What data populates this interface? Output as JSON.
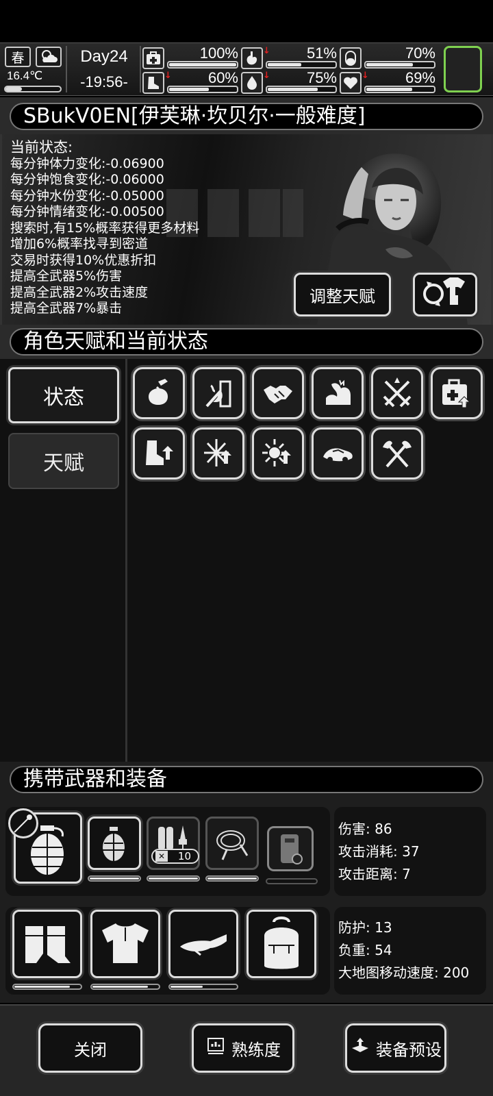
{
  "topbar": {
    "season": "春",
    "temperature": "16.4℃",
    "temperature_level": 0.3,
    "day": "Day24",
    "time": "-19:56-",
    "stats": [
      {
        "icon": "medkit-icon",
        "value": "100%",
        "level": 1.0,
        "declining": false
      },
      {
        "icon": "stomach-icon",
        "value": "51%",
        "level": 0.51,
        "declining": true
      },
      {
        "icon": "capsule-icon",
        "value": "70%",
        "level": 0.7,
        "declining": false
      },
      {
        "icon": "boot-icon",
        "value": "60%",
        "level": 0.6,
        "declining": true
      },
      {
        "icon": "water-drop-icon",
        "value": "75%",
        "level": 0.75,
        "declining": true
      },
      {
        "icon": "heart-icon",
        "value": "69%",
        "level": 0.69,
        "declining": true
      }
    ]
  },
  "character": {
    "name": "SBukV0EN[伊芙琳·坎贝尔·一般难度]",
    "status_title": "当前状态:",
    "status_lines": [
      "每分钟体力变化:-0.06900",
      "每分钟饱食变化:-0.06000",
      "每分钟水份变化:-0.05000",
      "每分钟情绪变化:-0.00500",
      "搜索时,有15%概率获得更多材料",
      "增加6%概率找寻到密道",
      "交易时获得10%优惠折扣",
      "提高全武器5%伤害",
      "提高全武器2%攻击速度",
      "提高全武器7%暴击"
    ],
    "adjust_button": "调整天赋"
  },
  "talents": {
    "header": "角色天赋和当前状态",
    "tab_status": "状态",
    "tab_talent": "天赋",
    "icons": [
      "bag-grab-icon",
      "fire-door-icon",
      "handshake-icon",
      "strong-arm-icon",
      "crossed-swords-icon",
      "medkit-up-icon",
      "boot-up-icon",
      "cold-up-icon",
      "heat-up-icon",
      "car-icon",
      "crossed-axes-icon"
    ]
  },
  "equipment": {
    "header": "携带武器和装备",
    "weapon_stats": [
      "伤害: 86",
      "攻击消耗: 37",
      "攻击距离:  7"
    ],
    "armor_stats": [
      "防护: 13",
      "负重: 54",
      "大地图移动速度:  200"
    ],
    "ammo_count": "10",
    "weapon_slots": [
      {
        "icon": "grenade-icon",
        "durability": 1.0
      },
      {
        "icon": "molotov-bottles-icon",
        "durability": 1.0
      },
      {
        "icon": "whip-icon",
        "durability": 1.0
      },
      {
        "icon": "riot-shield-icon",
        "durability": 0.0
      }
    ],
    "gear_slots": [
      {
        "icon": "gloves-icon",
        "durability": 0.85
      },
      {
        "icon": "shirt-icon",
        "durability": 0.85
      },
      {
        "icon": "visor-cap-icon",
        "durability": 0.5
      },
      {
        "icon": "backpack-icon",
        "durability": 0.0
      }
    ]
  },
  "footer": {
    "close": "关闭",
    "proficiency": "熟练度",
    "preset": "装备预设"
  }
}
